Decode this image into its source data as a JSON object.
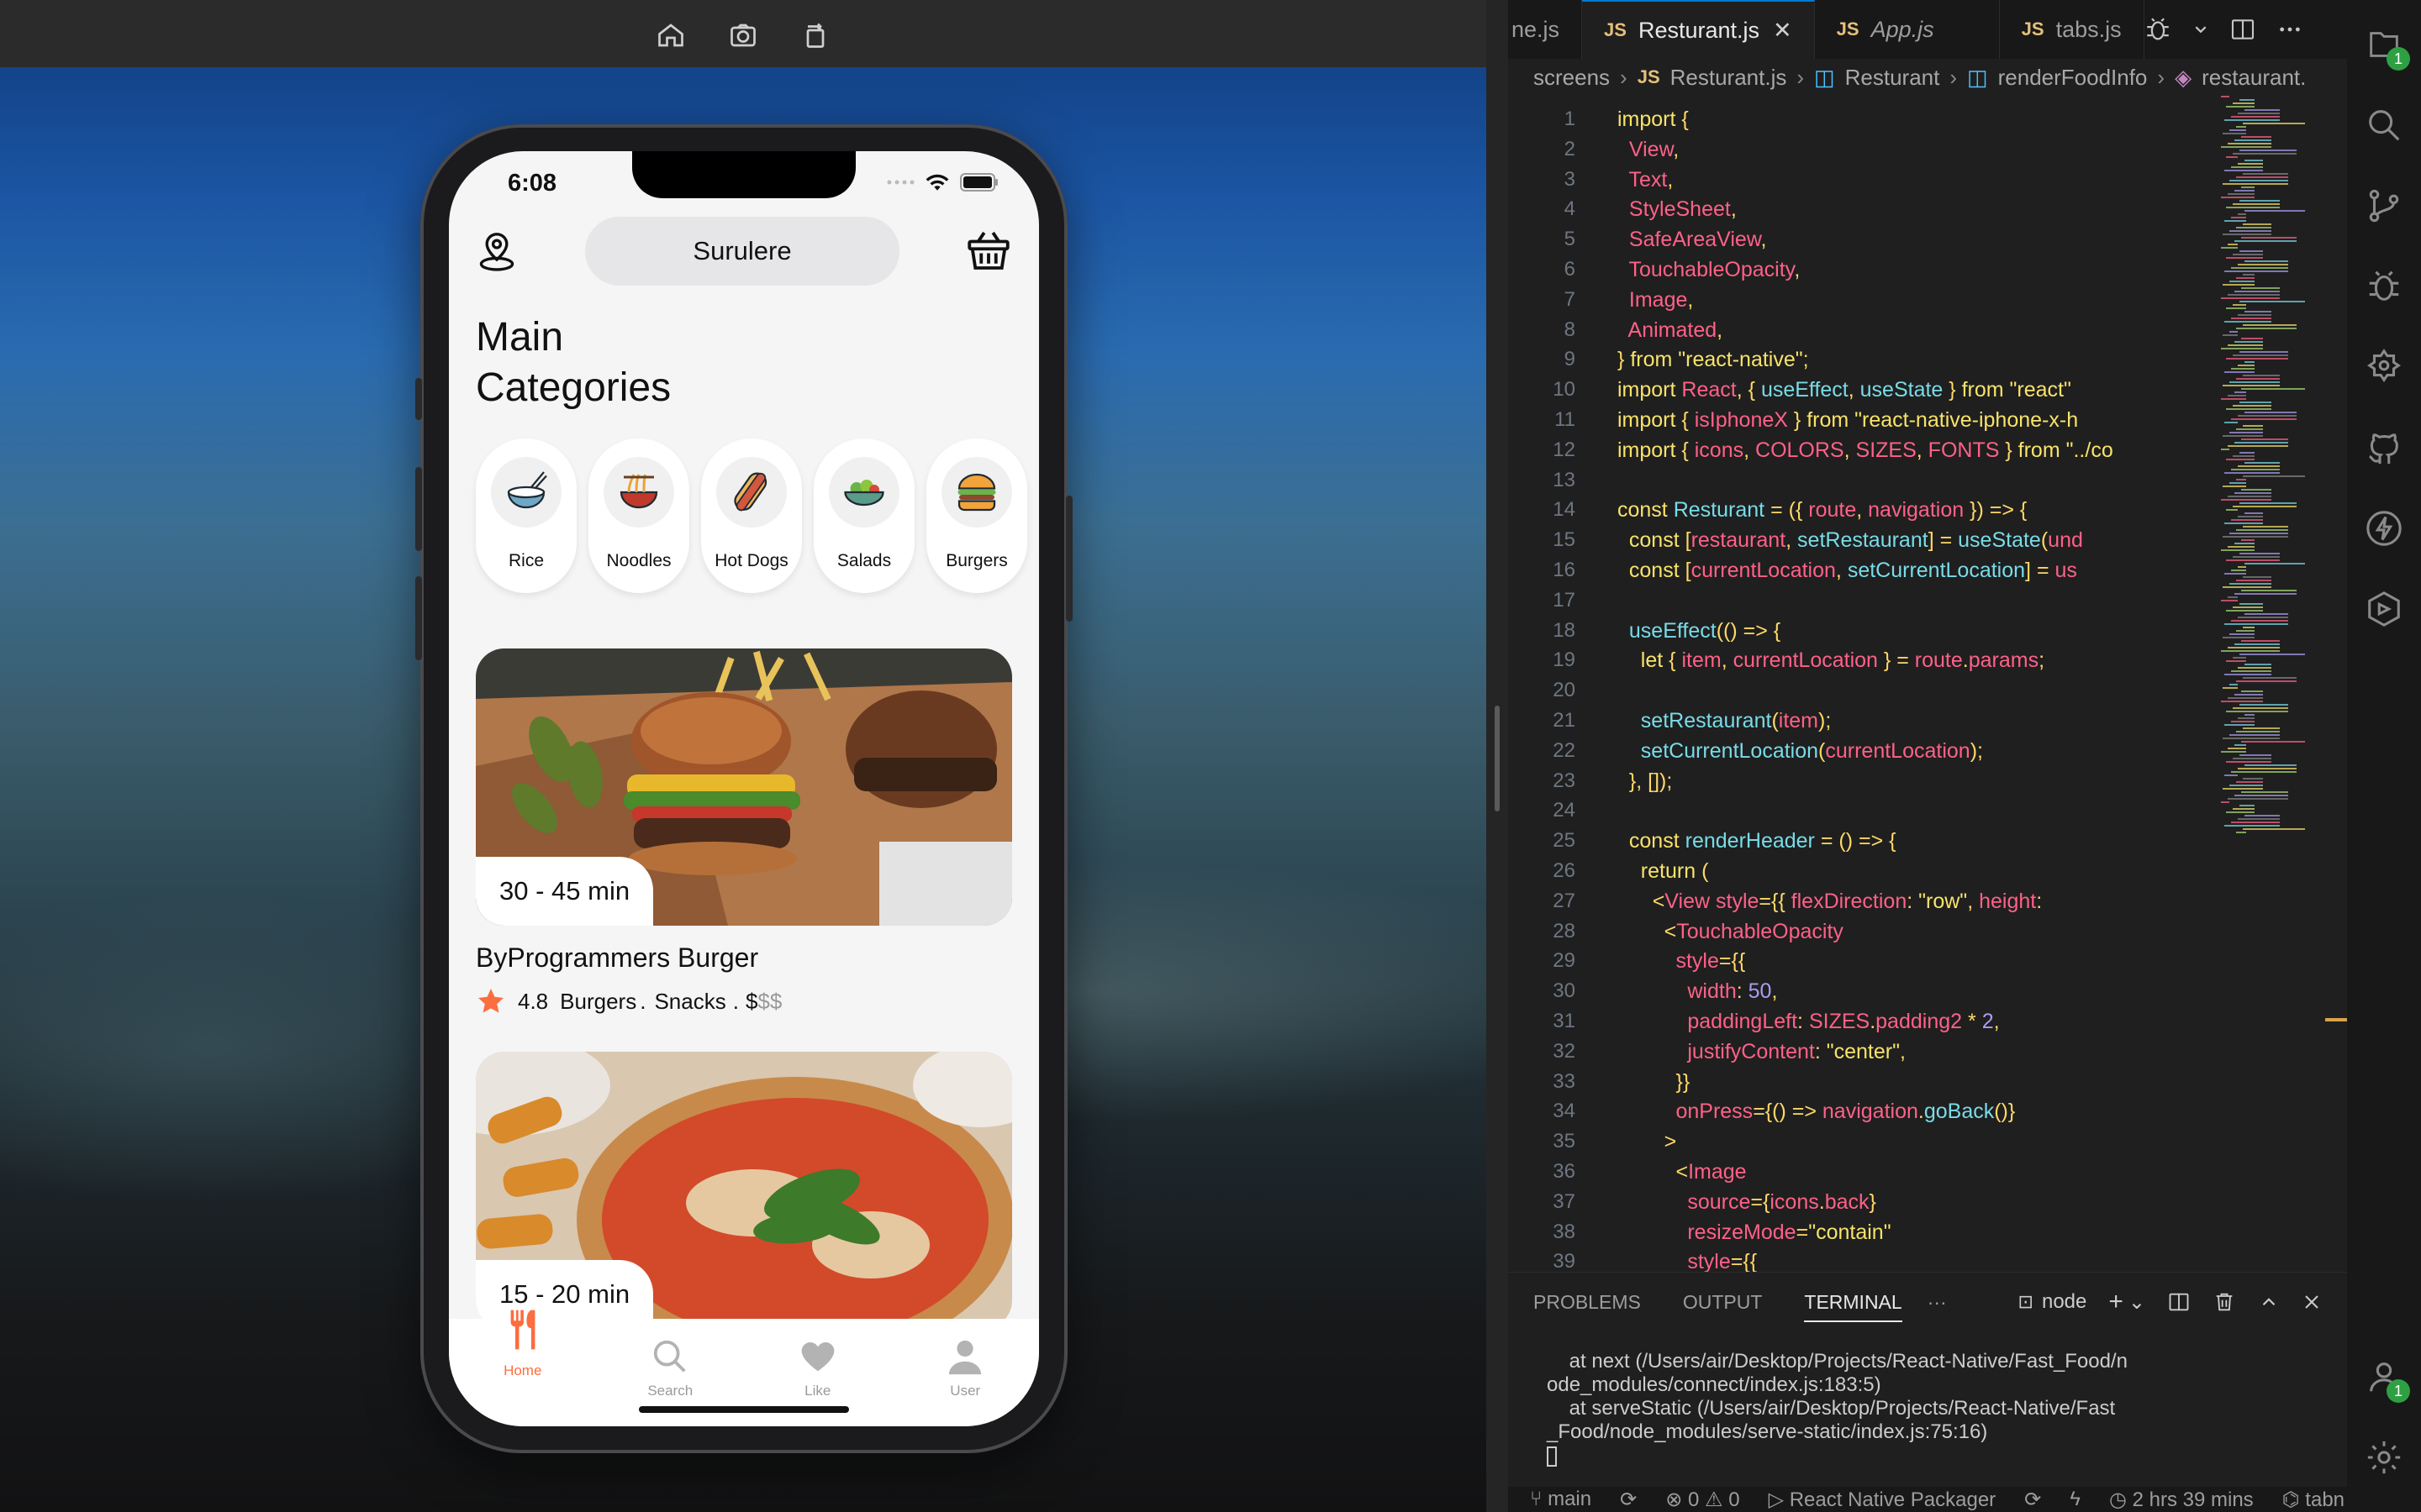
{
  "simulator": {
    "toolbar": {
      "icons": [
        "home-icon",
        "screenshot-icon",
        "rotate-icon"
      ]
    },
    "status_bar": {
      "time": "6:08"
    },
    "header": {
      "location": "Surulere"
    },
    "section_title": "Main Categories",
    "categories": [
      {
        "label": "Rice",
        "icon": "rice-bowl-icon"
      },
      {
        "label": "Noodles",
        "icon": "noodles-icon"
      },
      {
        "label": "Hot Dogs",
        "icon": "hotdog-icon"
      },
      {
        "label": "Salads",
        "icon": "salad-icon"
      },
      {
        "label": "Burgers",
        "icon": "burger-icon"
      }
    ],
    "restaurants": [
      {
        "duration": "30 - 45 min",
        "name": "ByProgrammers Burger",
        "rating": "4.8",
        "tags": [
          "Burgers",
          ".",
          "Snacks",
          "."
        ],
        "price": "$",
        "price_dim": "$$"
      },
      {
        "duration": "15 - 20 min"
      }
    ],
    "tabbar": [
      {
        "label": "Home",
        "icon": "cutlery-icon",
        "active": true
      },
      {
        "label": "Search",
        "icon": "search-icon"
      },
      {
        "label": "Like",
        "icon": "heart-icon"
      },
      {
        "label": "User",
        "icon": "user-icon"
      }
    ],
    "accent": "#fc6d3f"
  },
  "editor": {
    "tabs": [
      {
        "name": "ne.js",
        "active": false
      },
      {
        "name": "Resturant.js",
        "active": true
      },
      {
        "name": "App.js",
        "active": false,
        "italic": true
      },
      {
        "name": "tabs.js",
        "active": false
      }
    ],
    "breadcrumb": [
      "screens",
      "Resturant.js",
      "Resturant",
      "renderFoodInfo",
      "restaurant."
    ],
    "lines": [
      "import {",
      "  View,",
      "  Text,",
      "  StyleSheet,",
      "  SafeAreaView,",
      "  TouchableOpacity,",
      "  Image,",
      "  Animated,",
      "} from \"react-native\";",
      "import React, { useEffect, useState } from \"react\"",
      "import { isIphoneX } from \"react-native-iphone-x-h",
      "import { icons, COLORS, SIZES, FONTS } from \"../co",
      "",
      "const Resturant = ({ route, navigation }) => {",
      "  const [restaurant, setRestaurant] = useState(und",
      "  const [currentLocation, setCurrentLocation] = us",
      "",
      "  useEffect(() => {",
      "    let { item, currentLocation } = route.params;",
      "",
      "    setRestaurant(item);",
      "    setCurrentLocation(currentLocation);",
      "  }, []);",
      "",
      "  const renderHeader = () => {",
      "    return (",
      "      <View style={{ flexDirection: \"row\", height:",
      "        <TouchableOpacity",
      "          style={{",
      "            width: 50,",
      "            paddingLeft: SIZES.padding2 * 2,",
      "            justifyContent: \"center\",",
      "          }}",
      "          onPress={() => navigation.goBack()}",
      "        >",
      "          <Image",
      "            source={icons.back}",
      "            resizeMode=\"contain\"",
      "            style={{"
    ],
    "panel": {
      "tabs": [
        "PROBLEMS",
        "OUTPUT",
        "TERMINAL",
        "···"
      ],
      "active_tab": "TERMINAL",
      "terminal_name": "node",
      "terminal_lines": [
        "    at next (/Users/air/Desktop/Projects/React-Native/Fast_Food/n",
        "ode_modules/connect/index.js:183:5)",
        "    at serveStatic (/Users/air/Desktop/Projects/React-Native/Fast",
        "_Food/node_modules/serve-static/index.js:75:16)"
      ]
    },
    "status": {
      "branch": "main",
      "errors": "0",
      "warnings": "0",
      "packager": "React Native Packager",
      "time": "2 hrs 39 mins",
      "tabnine": "tabn"
    },
    "activity_badges": {
      "explorer": "1",
      "accounts": "1"
    }
  }
}
